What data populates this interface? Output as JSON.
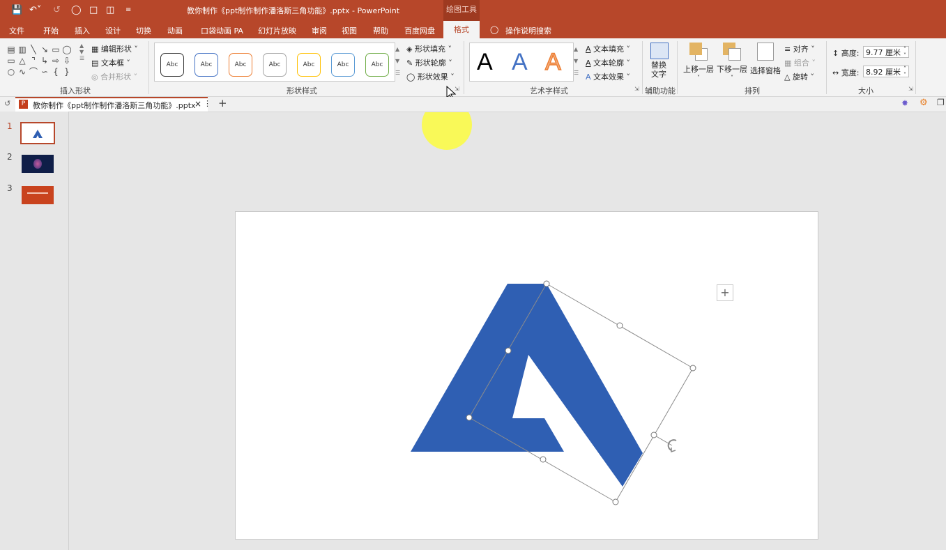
{
  "app": {
    "title": "教你制作《ppt制作制作潘洛斯三角功能》.pptx - PowerPoint",
    "context_label": "绘图工具"
  },
  "tabs": [
    "文件",
    "开始",
    "插入",
    "设计",
    "切换",
    "动画",
    "口袋动画 PA",
    "幻灯片放映",
    "审阅",
    "视图",
    "帮助",
    "百度网盘"
  ],
  "active_tab": "格式",
  "search_label": "操作说明搜索",
  "ribbon": {
    "insert_shapes": {
      "label": "插入形状",
      "edit_shape": "编辑形状",
      "textbox": "文本框",
      "merge_shapes": "合并形状"
    },
    "shape_styles": {
      "label": "形状样式",
      "samples": [
        "Abc",
        "Abc",
        "Abc",
        "Abc",
        "Abc",
        "Abc",
        "Abc"
      ],
      "sample_colors": [
        "#333333",
        "#4472c4",
        "#ed7d31",
        "#a5a5a5",
        "#ffc000",
        "#5b9bd5",
        "#70ad47"
      ],
      "fill": "形状填充",
      "outline": "形状轮廓",
      "effects": "形状效果"
    },
    "wordart": {
      "label": "艺术字样式",
      "text_fill": "文本填充",
      "text_outline": "文本轮廓",
      "text_effects": "文本效果",
      "glyph": "A"
    },
    "accessibility": {
      "label": "辅助功能",
      "alt_text": "替换文字"
    },
    "arrange": {
      "label": "排列",
      "bring_forward": "上移一层",
      "send_backward": "下移一层",
      "selection_pane": "选择窗格",
      "align": "对齐",
      "group": "组合",
      "rotate": "旋转"
    },
    "size": {
      "label": "大小",
      "height_label": "高度:",
      "height_value": "9.77 厘米",
      "width_label": "宽度:",
      "width_value": "8.92 厘米"
    }
  },
  "doc_tab": "教你制作《ppt制作制作潘洛斯三角功能》.pptx",
  "slides": [
    "1",
    "2",
    "3"
  ],
  "colors": {
    "accent": "#b7472a",
    "shape": "#2f5fb3"
  }
}
